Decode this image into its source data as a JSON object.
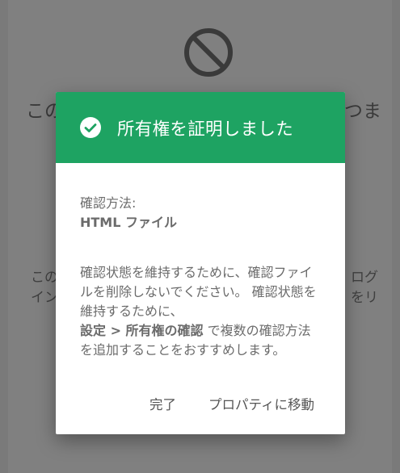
{
  "background": {
    "icon": "blocked-icon",
    "title_left": "この",
    "title_right": "つま",
    "body_row1_left": "この",
    "body_row1_right": "ログ",
    "body_row2_left": "イン",
    "body_row2_right": "をリ"
  },
  "dialog": {
    "header_color": "#1ea362",
    "icon": "check-circle-icon",
    "title": "所有権を証明しました",
    "method_label": "確認方法:",
    "method_value": "HTML ファイル",
    "desc_text_1": "確認状態を維持するために、確認ファイルを削除しないでください。 確認状態を維持するために、",
    "desc_bold": "設定 > 所有権の確認",
    "desc_text_2": " で複数の確認方法を追加することをおすすめします。",
    "done_label": "完了",
    "go_to_property_label": "プロパティに移動"
  }
}
